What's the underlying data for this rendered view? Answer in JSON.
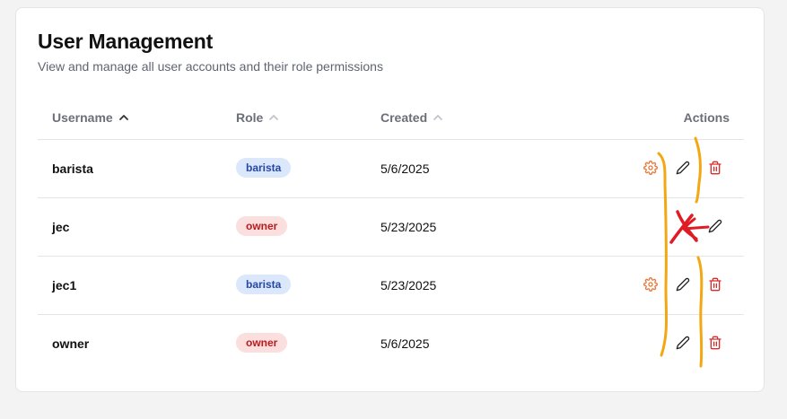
{
  "page": {
    "title": "User Management",
    "subtitle": "View and manage all user accounts and their role permissions"
  },
  "table": {
    "columns": [
      {
        "label": "Username",
        "sort": "ascending"
      },
      {
        "label": "Role",
        "sort": "ascending"
      },
      {
        "label": "Created",
        "sort": "ascending"
      },
      {
        "label": "Actions"
      }
    ],
    "rows": [
      {
        "username": "barista",
        "role": "barista",
        "created": "5/6/2025",
        "actions": [
          "gear-icon",
          "pencil-icon",
          "trash-icon"
        ]
      },
      {
        "username": "jec",
        "role": "owner",
        "created": "5/23/2025",
        "actions": [
          "pencil-icon"
        ]
      },
      {
        "username": "jec1",
        "role": "barista",
        "created": "5/23/2025",
        "actions": [
          "gear-icon",
          "pencil-icon",
          "trash-icon"
        ]
      },
      {
        "username": "owner",
        "role": "owner",
        "created": "5/6/2025",
        "actions": [
          "pencil-icon",
          "trash-icon"
        ]
      }
    ]
  },
  "colors": {
    "gear": "#e8793a",
    "trash": "#d92d2d",
    "pencil": "#222222",
    "barista_badge_bg": "#dbe7fb",
    "barista_badge_text": "#2547a8",
    "owner_badge_bg": "#fbdede",
    "owner_badge_text": "#b91c1c",
    "annotation_orange": "#f3a712",
    "annotation_red": "#e01b24"
  }
}
